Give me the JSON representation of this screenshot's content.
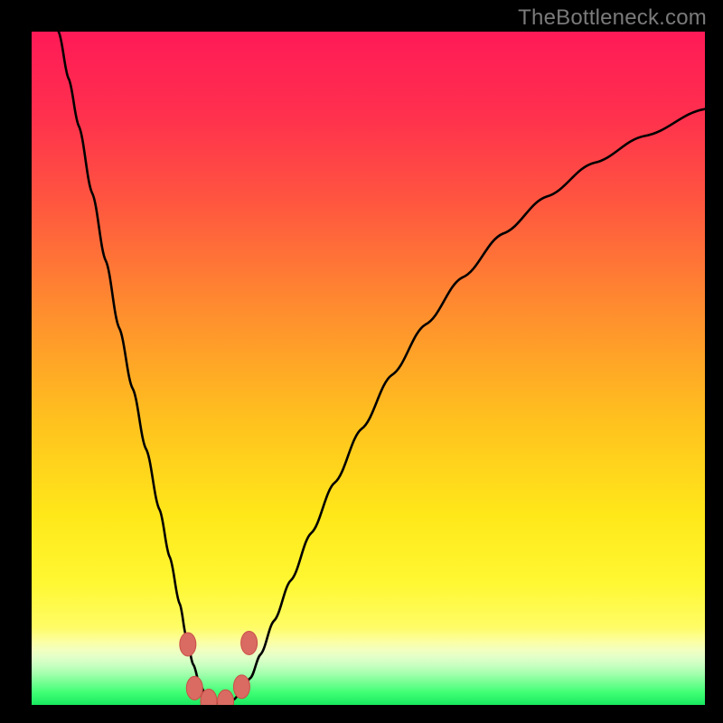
{
  "watermark": "TheBottleneck.com",
  "colors": {
    "black": "#000000",
    "curve": "#000000",
    "marker_fill": "#d96b63",
    "marker_stroke": "#c94f47",
    "gradient_stops": [
      {
        "offset": 0.0,
        "color": "#ff1a57"
      },
      {
        "offset": 0.12,
        "color": "#ff2f4e"
      },
      {
        "offset": 0.25,
        "color": "#ff5540"
      },
      {
        "offset": 0.42,
        "color": "#ff8f2e"
      },
      {
        "offset": 0.58,
        "color": "#ffc21e"
      },
      {
        "offset": 0.72,
        "color": "#ffe81a"
      },
      {
        "offset": 0.82,
        "color": "#fff833"
      },
      {
        "offset": 0.885,
        "color": "#fffc66"
      },
      {
        "offset": 0.905,
        "color": "#fcffa0"
      },
      {
        "offset": 0.918,
        "color": "#f2ffc0"
      },
      {
        "offset": 0.93,
        "color": "#e0ffc8"
      },
      {
        "offset": 0.942,
        "color": "#c6ffc0"
      },
      {
        "offset": 0.955,
        "color": "#9fffab"
      },
      {
        "offset": 0.968,
        "color": "#70ff90"
      },
      {
        "offset": 0.982,
        "color": "#3fff74"
      },
      {
        "offset": 1.0,
        "color": "#18e860"
      }
    ]
  },
  "chart_data": {
    "type": "line",
    "title": "",
    "xlabel": "",
    "ylabel": "",
    "x_range": [
      0,
      100
    ],
    "y_range": [
      0,
      100
    ],
    "curve_points": [
      {
        "x": 4.0,
        "y": 100.0
      },
      {
        "x": 5.5,
        "y": 93.0
      },
      {
        "x": 7.0,
        "y": 86.0
      },
      {
        "x": 9.0,
        "y": 76.0
      },
      {
        "x": 11.0,
        "y": 66.0
      },
      {
        "x": 13.0,
        "y": 56.0
      },
      {
        "x": 15.0,
        "y": 47.0
      },
      {
        "x": 17.0,
        "y": 38.0
      },
      {
        "x": 19.0,
        "y": 29.0
      },
      {
        "x": 20.5,
        "y": 22.0
      },
      {
        "x": 22.0,
        "y": 15.0
      },
      {
        "x": 23.0,
        "y": 10.0
      },
      {
        "x": 24.0,
        "y": 6.0
      },
      {
        "x": 25.0,
        "y": 3.0
      },
      {
        "x": 26.0,
        "y": 1.2
      },
      {
        "x": 27.0,
        "y": 0.5
      },
      {
        "x": 28.0,
        "y": 0.2
      },
      {
        "x": 29.0,
        "y": 0.3
      },
      {
        "x": 30.0,
        "y": 0.8
      },
      {
        "x": 31.0,
        "y": 1.8
      },
      {
        "x": 32.5,
        "y": 4.0
      },
      {
        "x": 34.0,
        "y": 7.5
      },
      {
        "x": 36.0,
        "y": 12.5
      },
      {
        "x": 38.5,
        "y": 18.5
      },
      {
        "x": 41.5,
        "y": 25.5
      },
      {
        "x": 45.0,
        "y": 33.0
      },
      {
        "x": 49.0,
        "y": 41.0
      },
      {
        "x": 53.5,
        "y": 49.0
      },
      {
        "x": 58.5,
        "y": 56.5
      },
      {
        "x": 64.0,
        "y": 63.5
      },
      {
        "x": 70.0,
        "y": 70.0
      },
      {
        "x": 76.5,
        "y": 75.5
      },
      {
        "x": 83.5,
        "y": 80.5
      },
      {
        "x": 91.0,
        "y": 84.5
      },
      {
        "x": 100.0,
        "y": 88.5
      }
    ],
    "markers": [
      {
        "x": 23.2,
        "y": 9.0
      },
      {
        "x": 24.2,
        "y": 2.5
      },
      {
        "x": 26.3,
        "y": 0.6
      },
      {
        "x": 28.8,
        "y": 0.5
      },
      {
        "x": 31.2,
        "y": 2.7
      },
      {
        "x": 32.3,
        "y": 9.2
      }
    ]
  }
}
